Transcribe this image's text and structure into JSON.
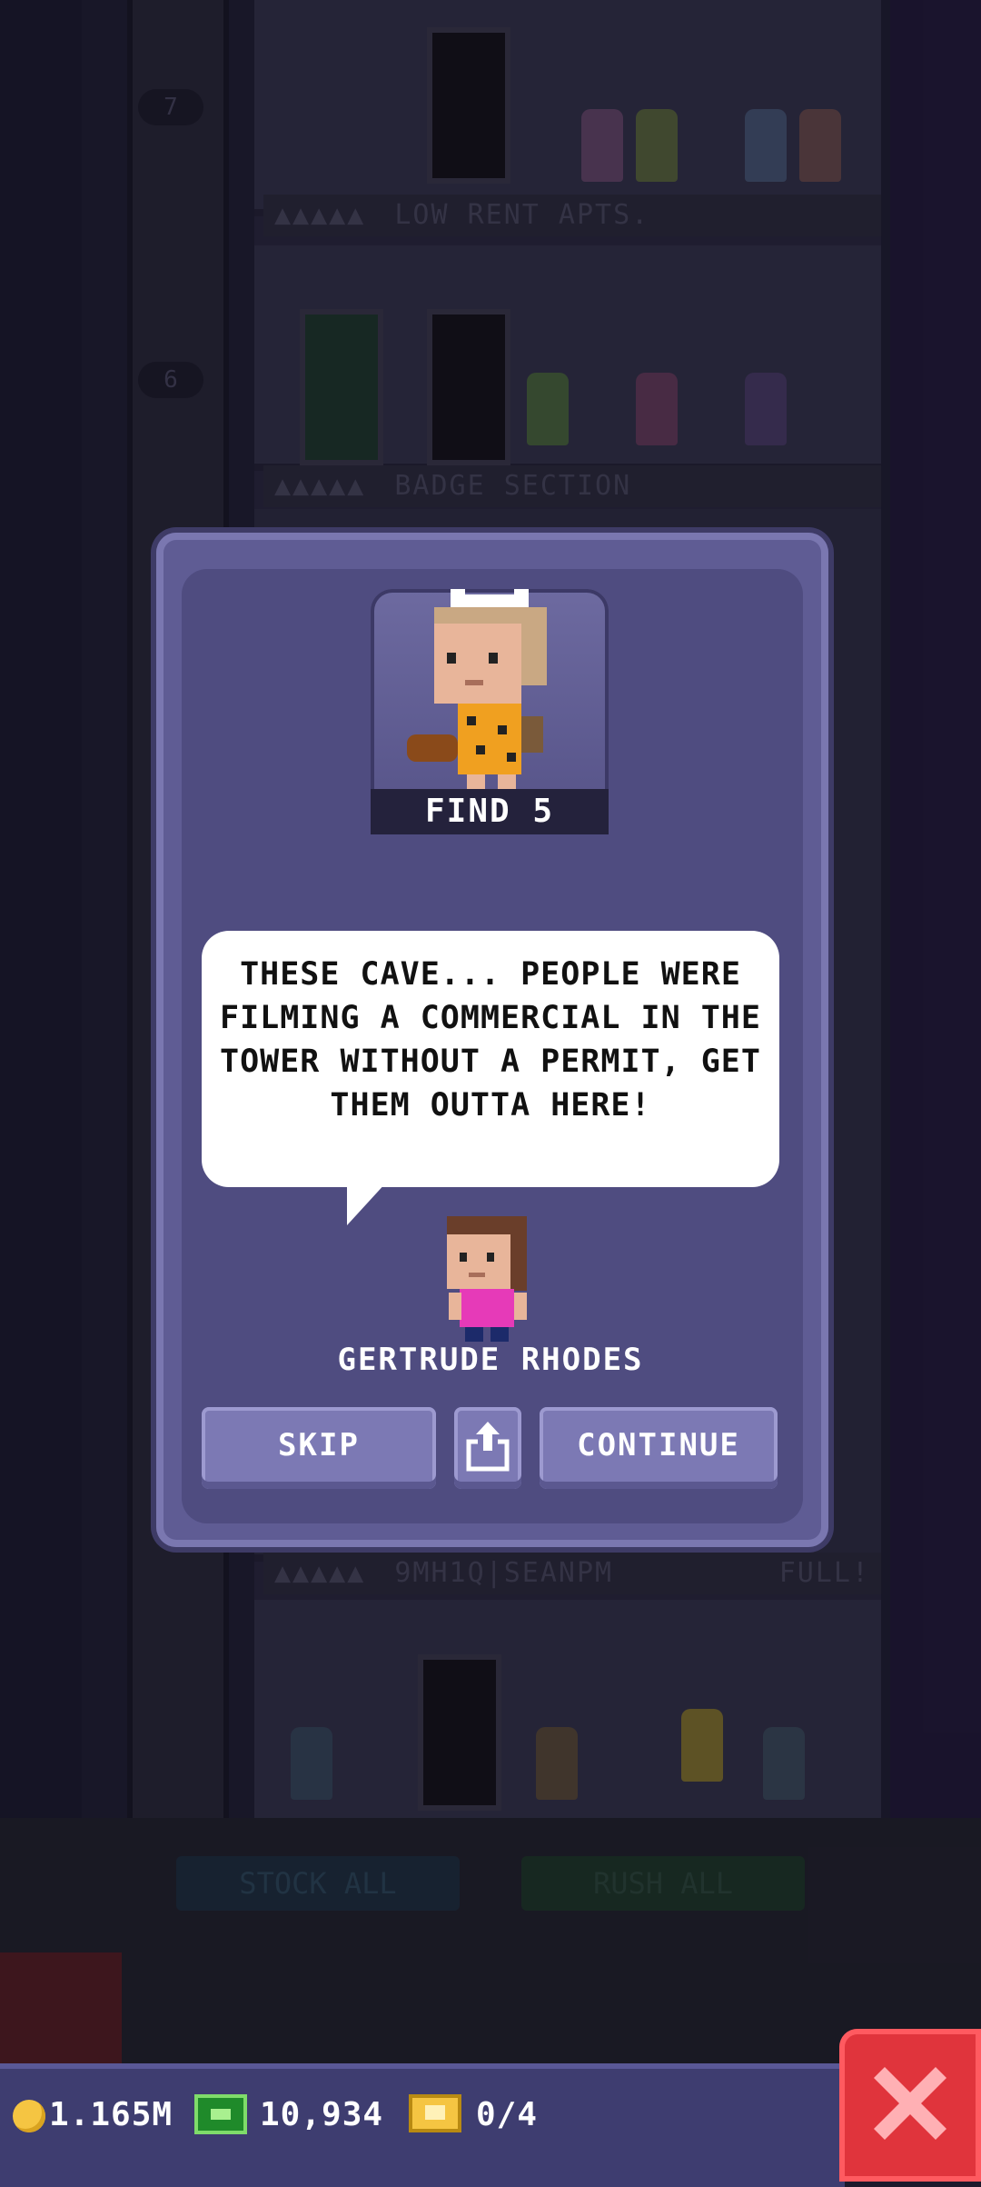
{
  "scene": {
    "floor_numbers": [
      "7",
      "6"
    ],
    "floor_labels": [
      {
        "name": "LOW RENT APTS."
      },
      {
        "name": "BADGE SECTION"
      },
      {
        "name": "9MH1Q|SEANPM",
        "status": "FULL!"
      }
    ],
    "stock_all_label": "STOCK ALL",
    "rush_all_label": "RUSH ALL",
    "rating_icon": "five-people-icon"
  },
  "dialog": {
    "mission": {
      "badge_label": "FIND 5",
      "portrait_icon": "caveman-character-icon"
    },
    "message": "THESE CAVE... PEOPLE WERE FILMING A COMMERCIAL IN THE TOWER WITHOUT A PERMIT, GET THEM OUTTA HERE!",
    "npc": {
      "name": "GERTRUDE RHODES",
      "avatar_icon": "bitizen-avatar-icon"
    },
    "buttons": {
      "skip": "SKIP",
      "share_icon": "share-icon",
      "continue": "CONTINUE"
    }
  },
  "status_bar": {
    "coins": "1.165M",
    "bux": "10,934",
    "tickets": "0/4",
    "close_icon": "close-icon"
  },
  "colors": {
    "dialog_bg": "#5f5c94",
    "button_bg": "#7c79b4",
    "close_red": "#e0343c",
    "status_bar": "#3e3d70"
  }
}
